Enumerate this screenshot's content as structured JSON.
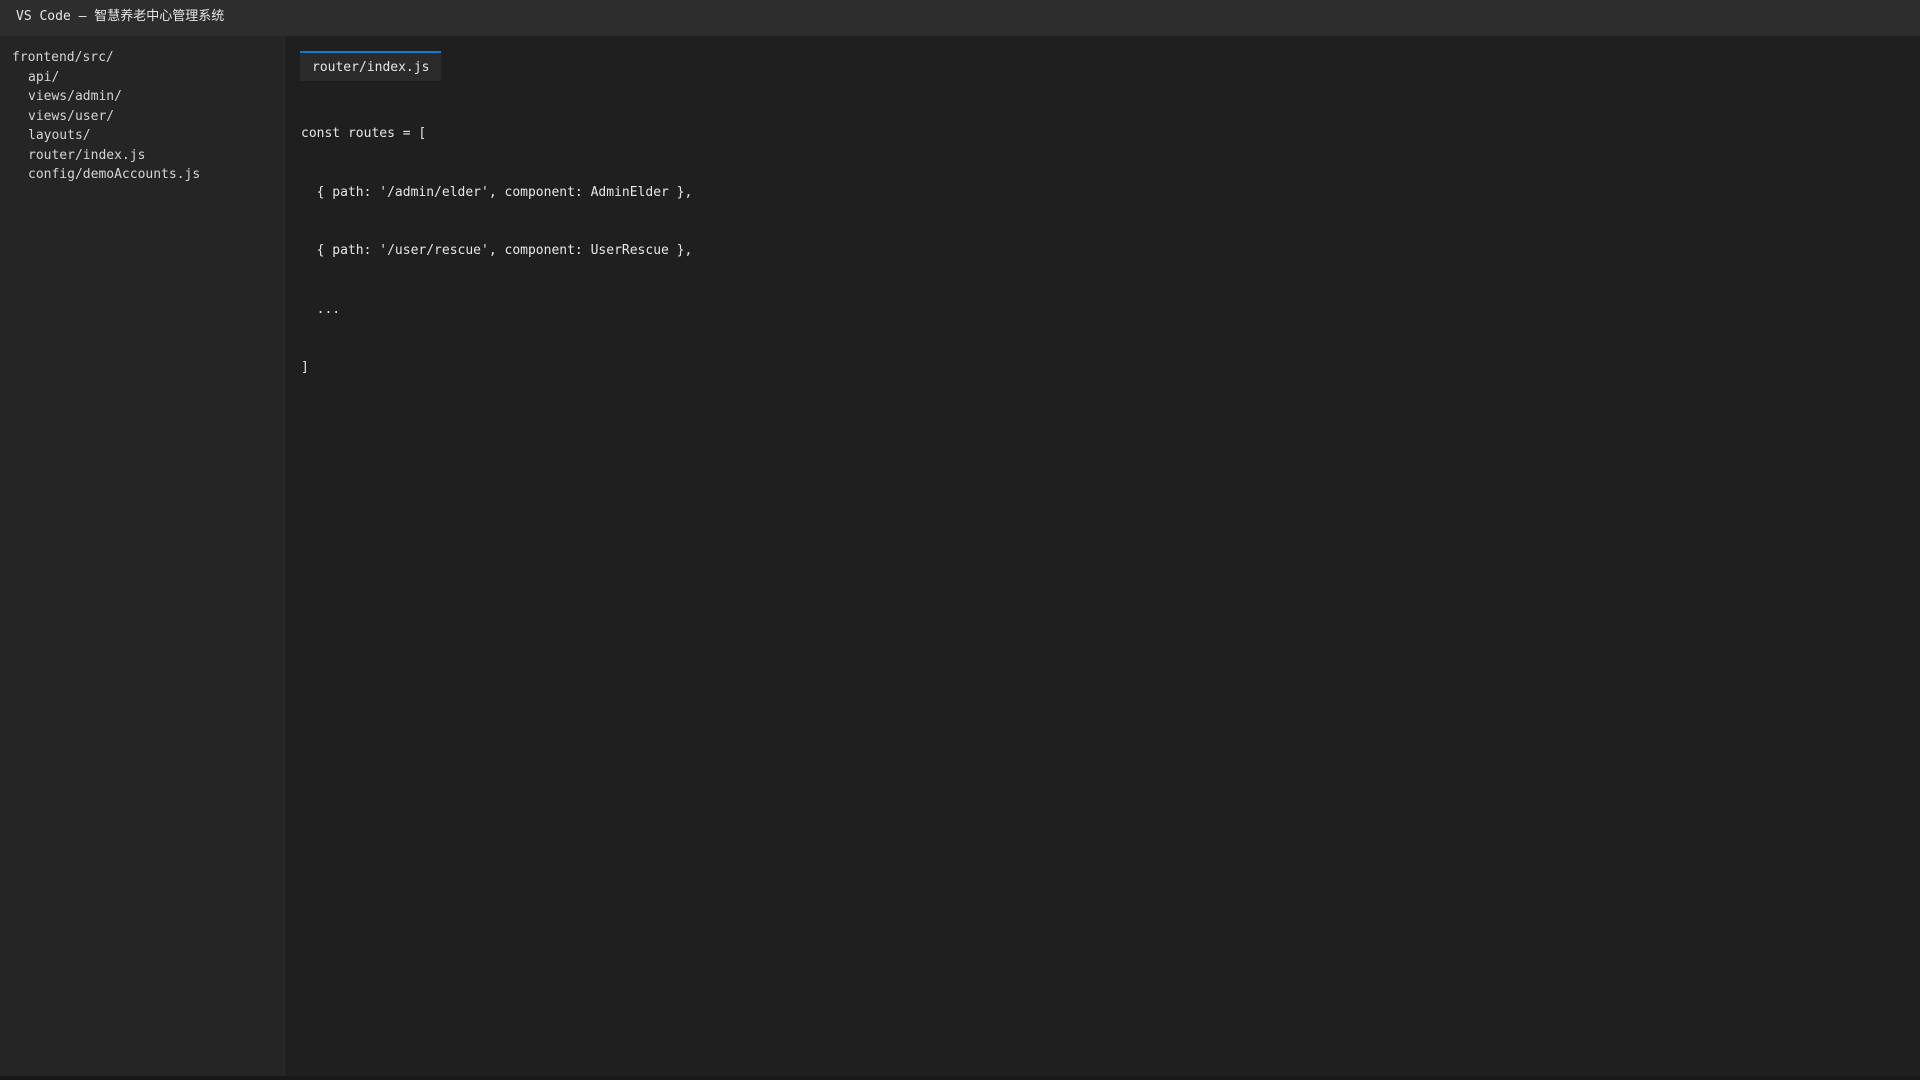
{
  "window": {
    "title": "VS Code — 智慧养老中心管理系统"
  },
  "explorer": {
    "root": "frontend/src/",
    "items": [
      "api/",
      "views/admin/",
      "views/user/",
      "layouts/",
      "router/index.js",
      "config/demoAccounts.js"
    ]
  },
  "editor": {
    "active_tab": "router/index.js",
    "lines": [
      "const routes = [",
      "  { path: '/admin/elder', component: AdminElder },",
      "  { path: '/user/rescue', component: UserRescue },",
      "  ...",
      "]"
    ]
  },
  "colors": {
    "tab_accent": "#0e7ad3",
    "titlebar": "#2d2d2d",
    "sidebar": "#252526",
    "editor_bg": "#1f1f1f"
  }
}
